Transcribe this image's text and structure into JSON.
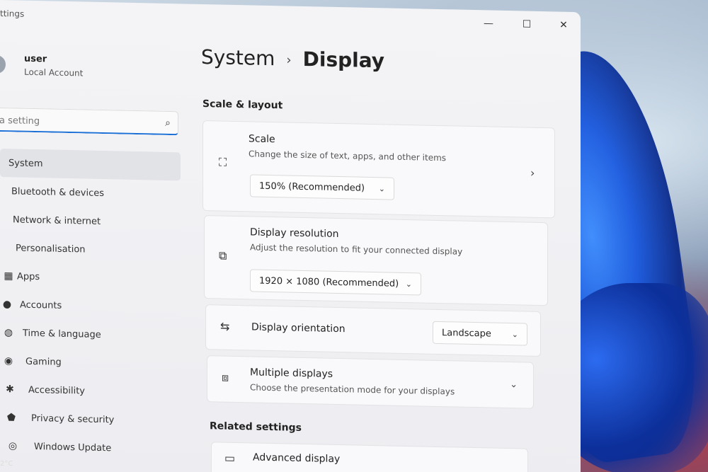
{
  "window": {
    "title": "ttings",
    "controls": {
      "minimize": "—",
      "maximize": "☐",
      "close": "✕"
    }
  },
  "user": {
    "name": "user",
    "type": "Local Account"
  },
  "search": {
    "placeholder": "a setting"
  },
  "nav": [
    {
      "label": "System",
      "icon": "monitor-icon",
      "glyph": "",
      "active": true
    },
    {
      "label": "Bluetooth & devices",
      "icon": "bluetooth-icon",
      "glyph": "",
      "active": false
    },
    {
      "label": "Network & internet",
      "icon": "wifi-icon",
      "glyph": "",
      "active": false
    },
    {
      "label": "Personalisation",
      "icon": "brush-icon",
      "glyph": "",
      "active": false
    },
    {
      "label": "Apps",
      "icon": "apps-icon",
      "glyph": "▦",
      "active": false
    },
    {
      "label": "Accounts",
      "icon": "person-icon",
      "glyph": "●",
      "active": false
    },
    {
      "label": "Time & language",
      "icon": "globe-icon",
      "glyph": "◍",
      "active": false
    },
    {
      "label": "Gaming",
      "icon": "gamepad-icon",
      "glyph": "◉",
      "active": false
    },
    {
      "label": "Accessibility",
      "icon": "accessibility-icon",
      "glyph": "✱",
      "active": false
    },
    {
      "label": "Privacy & security",
      "icon": "shield-icon",
      "glyph": "⬟",
      "active": false
    },
    {
      "label": "Windows Update",
      "icon": "update-icon",
      "glyph": "◎",
      "active": false
    }
  ],
  "breadcrumb": {
    "parent": "System",
    "separator": "›",
    "current": "Display"
  },
  "sections": {
    "scale_layout": "Scale & layout",
    "related": "Related settings"
  },
  "scale": {
    "title": "Scale",
    "description": "Change the size of text, apps, and other items",
    "value": "150% (Recommended)"
  },
  "resolution": {
    "title": "Display resolution",
    "description": "Adjust the resolution to fit your connected display",
    "value": "1920 × 1080 (Recommended)"
  },
  "orientation": {
    "title": "Display orientation",
    "value": "Landscape"
  },
  "multiple": {
    "title": "Multiple displays",
    "description": "Choose the presentation mode for your displays"
  },
  "advanced": {
    "title": "Advanced display"
  },
  "taskbar": {
    "temperature": "2°C"
  },
  "colors": {
    "accent": "#1a6fd6"
  }
}
